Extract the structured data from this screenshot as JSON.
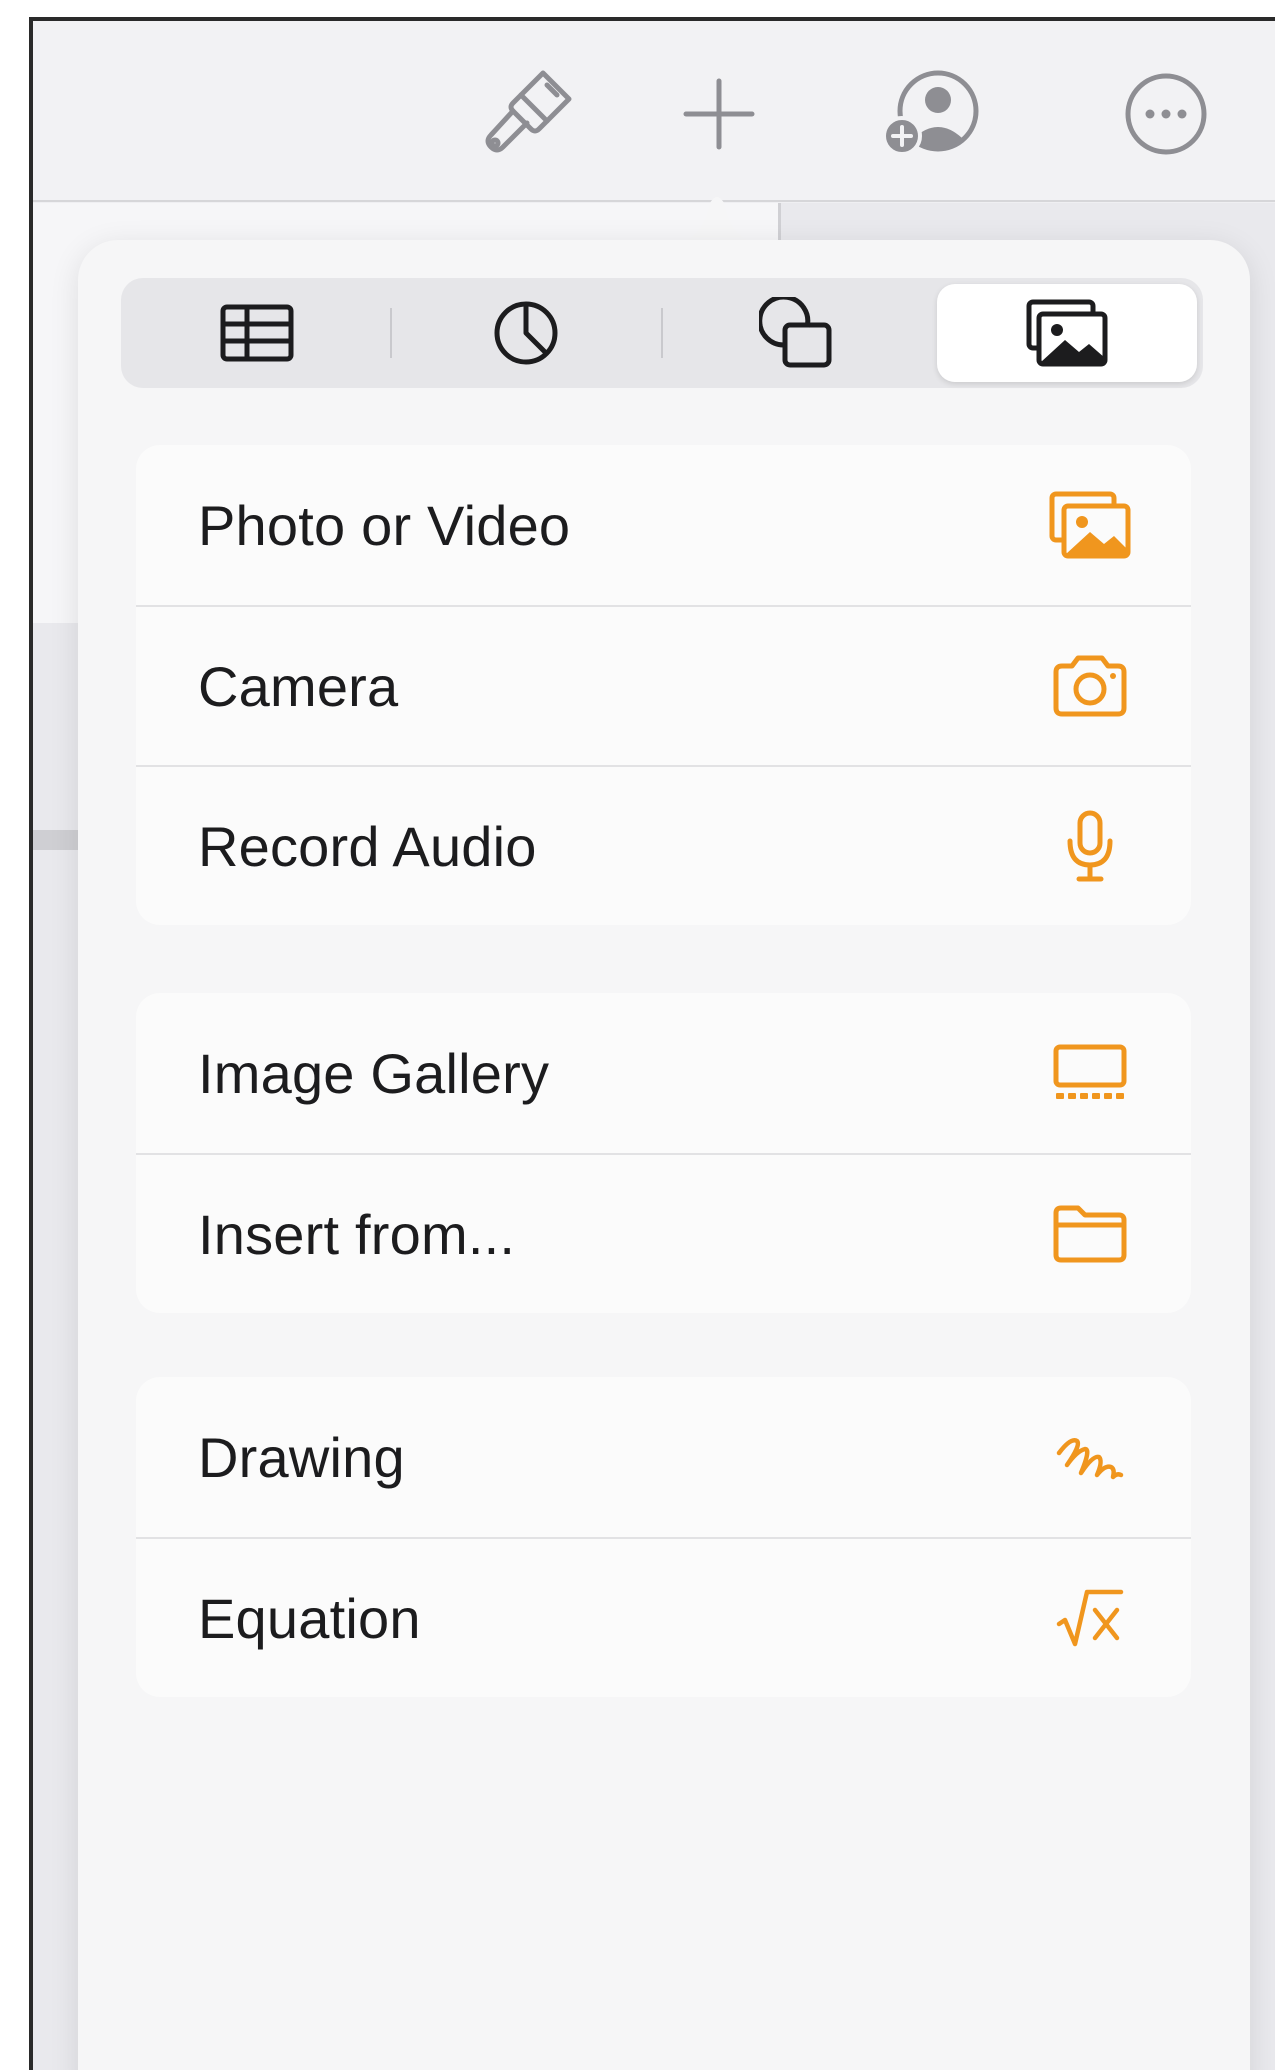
{
  "toolbar": {
    "icons": [
      "paintbrush-icon",
      "plus-icon",
      "add-collaborator-icon",
      "more-icon"
    ]
  },
  "segments": {
    "items": [
      "table-icon",
      "chart-icon",
      "shapes-icon",
      "media-icon"
    ],
    "selected": "media-icon"
  },
  "menu": {
    "groups": [
      {
        "items": [
          {
            "label": "Photo or Video",
            "icon": "photo-icon"
          },
          {
            "label": "Camera",
            "icon": "camera-icon"
          },
          {
            "label": "Record Audio",
            "icon": "microphone-icon"
          }
        ]
      },
      {
        "items": [
          {
            "label": "Image Gallery",
            "icon": "image-gallery-icon"
          },
          {
            "label": "Insert from...",
            "icon": "folder-icon"
          }
        ]
      },
      {
        "items": [
          {
            "label": "Drawing",
            "icon": "drawing-icon"
          },
          {
            "label": "Equation",
            "icon": "equation-icon"
          }
        ]
      }
    ]
  },
  "colors": {
    "accent": "#f0961e",
    "text": "#1c1c1e",
    "toolbar_icon": "#8e8e93"
  }
}
